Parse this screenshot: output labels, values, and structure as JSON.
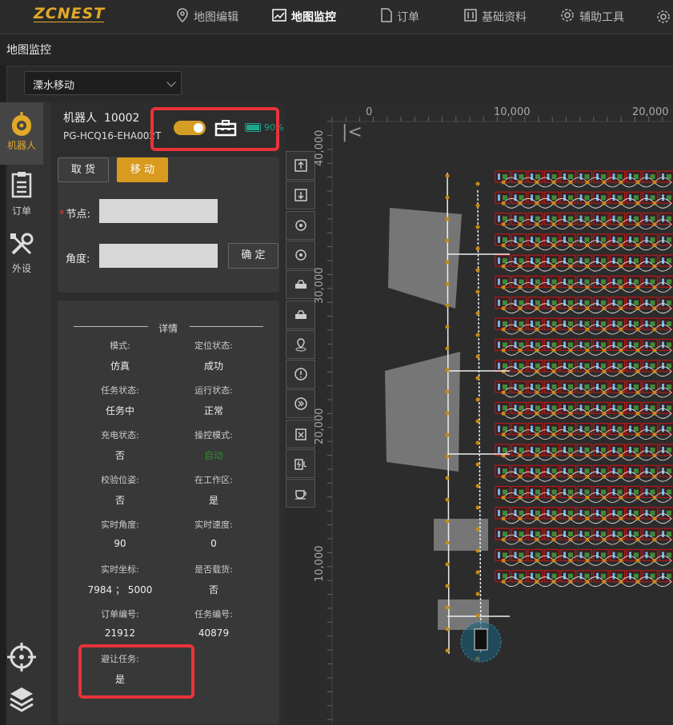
{
  "app": {
    "logo": "ZCNEST"
  },
  "nav": [
    {
      "label": "地图编辑",
      "icon": "map-pin-icon"
    },
    {
      "label": "地图监控",
      "icon": "chart-icon"
    },
    {
      "label": "订单",
      "icon": "document-icon"
    },
    {
      "label": "基础资料",
      "icon": "database-icon"
    },
    {
      "label": "辅助工具",
      "icon": "gear-icon"
    }
  ],
  "page": {
    "title": "地图监控"
  },
  "map_select": {
    "value": "溧水移动"
  },
  "sidebar": [
    {
      "label": "机器人",
      "icon": "robot-icon"
    },
    {
      "label": "订单",
      "icon": "clipboard-icon"
    },
    {
      "label": "外设",
      "icon": "tools-icon"
    }
  ],
  "robot": {
    "name_label": "机器人",
    "id": "10002",
    "code": "PG-HCQ16-EHA002T",
    "battery": "90%",
    "toggle": "on"
  },
  "controls": {
    "pickup_label": "取 货",
    "move_label": "移 动",
    "node_label": "节点:",
    "angle_label": "角度:",
    "confirm_label": "确 定",
    "node_value": "",
    "angle_value": ""
  },
  "details": {
    "title": "详情",
    "items": [
      {
        "label": "模式:",
        "value": "仿真"
      },
      {
        "label": "定位状态:",
        "value": "成功"
      },
      {
        "label": "任务状态:",
        "value": "任务中"
      },
      {
        "label": "运行状态:",
        "value": "正常"
      },
      {
        "label": "充电状态:",
        "value": "否"
      },
      {
        "label": "操控模式:",
        "value": "自动"
      },
      {
        "label": "校验位姿:",
        "value": "否"
      },
      {
        "label": "在工作区:",
        "value": "是"
      },
      {
        "label": "实时角度:",
        "value": "90"
      },
      {
        "label": "实时速度:",
        "value": "0"
      },
      {
        "label": "实时坐标:",
        "value": "7984 ； 5000"
      },
      {
        "label": "是否载货:",
        "value": "否"
      },
      {
        "label": "订单编号:",
        "value": "21912"
      },
      {
        "label": "任务编号:",
        "value": "40879"
      },
      {
        "label": "避让任务:",
        "value": "是"
      }
    ]
  },
  "map": {
    "x_ticks": [
      "0",
      "10,000",
      "20,000"
    ],
    "y_ticks": [
      "40,000",
      "30,000",
      "20,000",
      "10,000"
    ]
  },
  "colors": {
    "accent": "#d89a1f",
    "highlight": "#e8333a",
    "battery": "#1ea58c",
    "auto": "#2f8a2f"
  }
}
